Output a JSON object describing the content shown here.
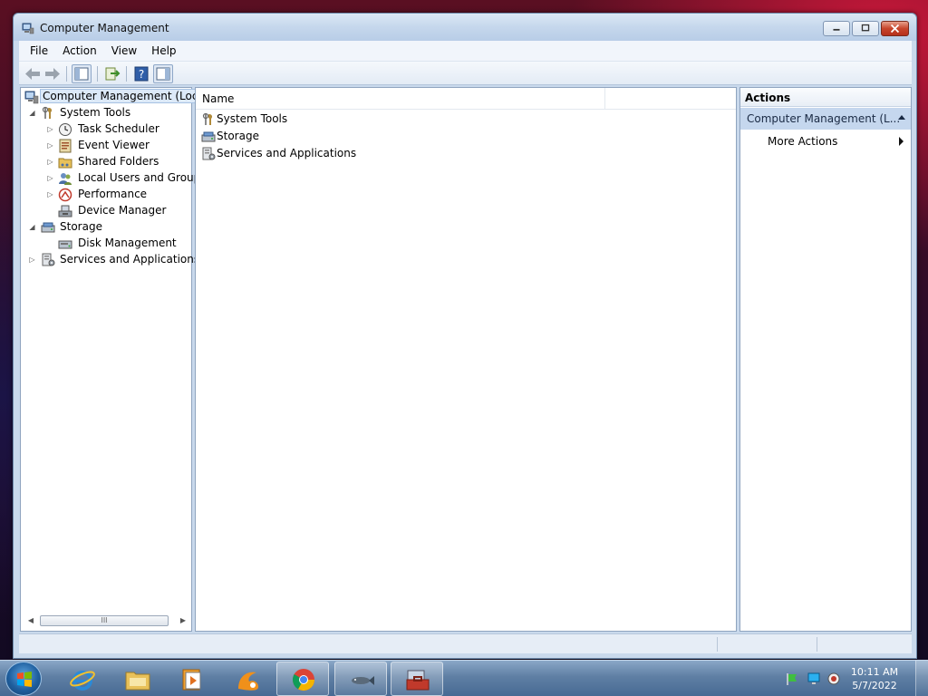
{
  "window": {
    "title": "Computer Management"
  },
  "menu": {
    "items": [
      "File",
      "Action",
      "View",
      "Help"
    ]
  },
  "toolbar": {
    "buttons": [
      "back-icon",
      "forward-icon",
      "show-hide-console-tree-icon",
      "export-list-icon",
      "help-icon",
      "show-hide-action-pane-icon"
    ]
  },
  "tree": {
    "root": "Computer Management (Local",
    "system_tools": "System Tools",
    "task_scheduler": "Task Scheduler",
    "event_viewer": "Event Viewer",
    "shared_folders": "Shared Folders",
    "local_users": "Local Users and Groups",
    "performance": "Performance",
    "device_manager": "Device Manager",
    "storage": "Storage",
    "disk_management": "Disk Management",
    "services": "Services and Applications",
    "scroll_grip": "III"
  },
  "list": {
    "column_name": "Name",
    "items": [
      "System Tools",
      "Storage",
      "Services and Applications"
    ]
  },
  "actions": {
    "header": "Actions",
    "group": "Computer Management (L...",
    "more_actions": "More Actions"
  },
  "taskbar": {
    "apps": [
      "internet-explorer-icon",
      "windows-explorer-icon",
      "media-player-icon",
      "uc-browser-icon",
      "chrome-icon",
      "fish-app-icon",
      "computer-management-toolbox-icon"
    ],
    "time": "10:11 AM",
    "date": "5/7/2022"
  },
  "colors": {
    "titlebar": "#c5d7ec",
    "selection": "#dce9f8",
    "actions_group": "#c5d7ee",
    "close_button": "#c7452b",
    "taskbar": "#5f7fa4"
  }
}
